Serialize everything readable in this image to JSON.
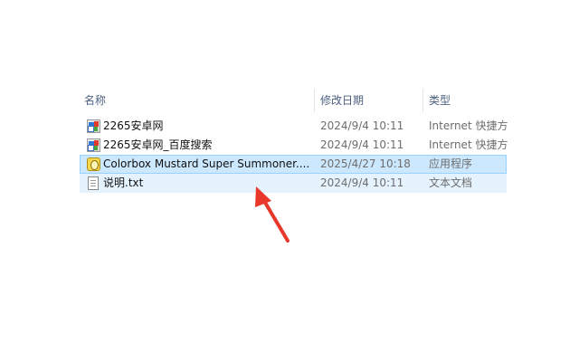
{
  "columns": {
    "name": "名称",
    "date": "修改日期",
    "type": "类型"
  },
  "files": [
    {
      "name": "2265安卓网",
      "date": "2024/9/4 10:11",
      "type": "Internet 快捷方",
      "icon": "internet-shortcut-icon"
    },
    {
      "name": "2265安卓网_百度搜索",
      "date": "2024/9/4 10:11",
      "type": "Internet 快捷方",
      "icon": "internet-shortcut-icon"
    },
    {
      "name": "Colorbox Mustard Super Summoner....",
      "date": "2025/4/27 10:18",
      "type": "应用程序",
      "icon": "application-icon",
      "state": "selected"
    },
    {
      "name": "说明.txt",
      "date": "2024/9/4 10:11",
      "type": "文本文档",
      "icon": "text-file-icon",
      "state": "hover"
    }
  ],
  "annotation": {
    "color": "#e8382c",
    "icon": "red-arrow-annotation"
  }
}
